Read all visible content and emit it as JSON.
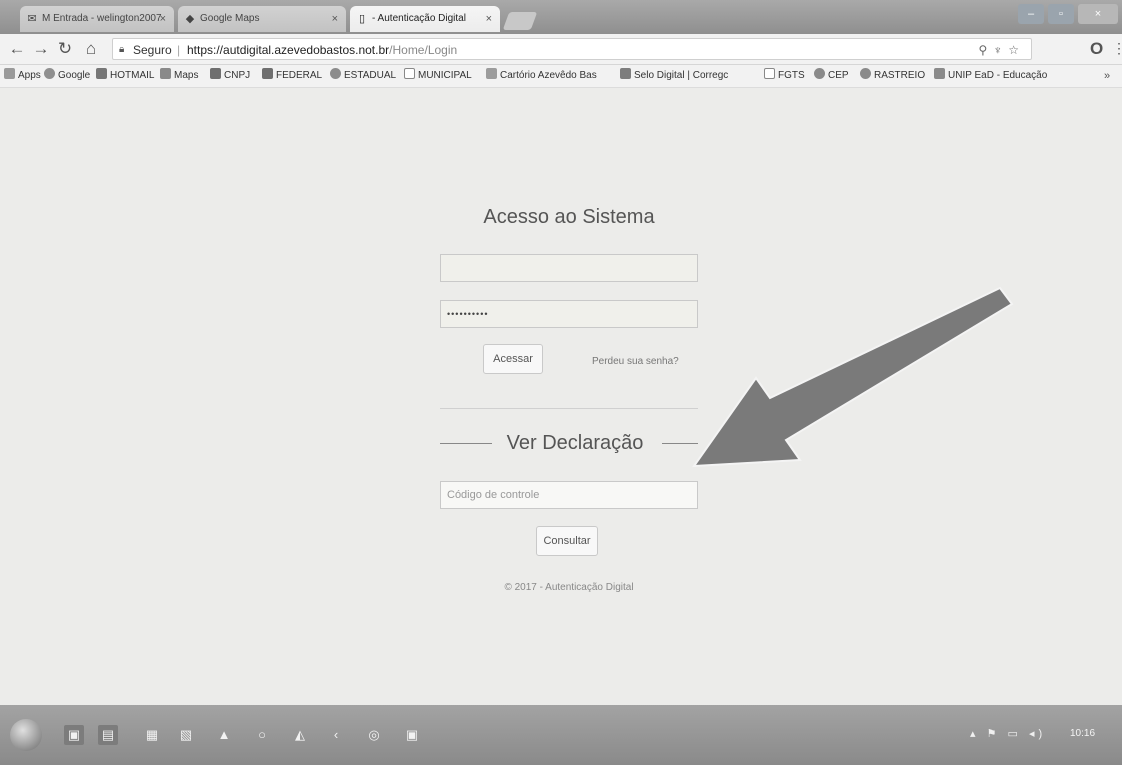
{
  "browser": {
    "tabs": [
      {
        "label": "M Entrada - welington2007",
        "icon": "gmail-icon"
      },
      {
        "label": "Google Maps",
        "icon": "maps-icon"
      },
      {
        "label": "- Autenticação Digital",
        "icon": "page-icon",
        "active": true
      }
    ],
    "address": {
      "secure_label": "Seguro",
      "url_host": "https://autdigital.azevedobastos.not.br",
      "url_path": "/Home/Login"
    },
    "bookmarks": [
      {
        "label": "Apps",
        "icon": "apps-icon"
      },
      {
        "label": "Google",
        "icon": "google-icon"
      },
      {
        "label": "HOTMAIL",
        "icon": "hotmail-icon"
      },
      {
        "label": "Maps",
        "icon": "maps-icon"
      },
      {
        "label": "CNPJ",
        "icon": "bookmark-icon"
      },
      {
        "label": "FEDERAL",
        "icon": "bookmark-icon"
      },
      {
        "label": "ESTADUAL",
        "icon": "bookmark-icon"
      },
      {
        "label": "MUNICIPAL",
        "icon": "page-icon"
      },
      {
        "label": "Cartório Azevêdo Bas",
        "icon": "bookmark-icon"
      },
      {
        "label": "Selo Digital | Corregc",
        "icon": "bookmark-icon"
      },
      {
        "label": "FGTS",
        "icon": "page-icon"
      },
      {
        "label": "CEP",
        "icon": "bookmark-icon"
      },
      {
        "label": "RASTREIO",
        "icon": "bookmark-icon"
      },
      {
        "label": "UNIP EaD - Educação",
        "icon": "bookmark-icon"
      }
    ],
    "more": "»"
  },
  "login": {
    "title": "Acesso ao Sistema",
    "username_value": "",
    "password_value": "••••••••••",
    "submit_label": "Acessar",
    "forgot_label": "Perdeu sua senha?"
  },
  "declaration": {
    "title": "Ver Declaração",
    "code_placeholder": "Código de controle",
    "submit_label": "Consultar"
  },
  "footer": "© 2017 - Autenticação Digital",
  "taskbar": {
    "clock": "10:16"
  },
  "colors": {
    "page_bg": "#ececea",
    "arrow_fill": "#7a7a7a",
    "field_bg": "#f0f0eb"
  }
}
